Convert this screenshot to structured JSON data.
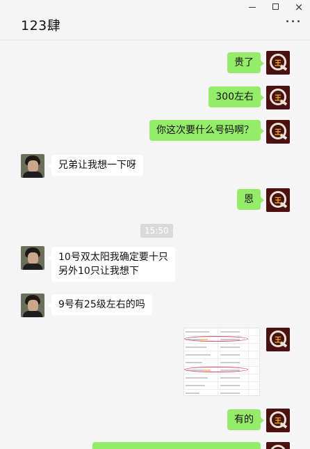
{
  "window": {
    "title": "123肆",
    "controls": {
      "minimize": "minimize",
      "maximize": "maximize",
      "close": "×"
    },
    "more_icon": "more-horizontal-icon"
  },
  "colors": {
    "background": "#f5f5f5",
    "my_bubble": "#95ec69",
    "other_bubble": "#ffffff",
    "my_avatar": "#4b1010"
  },
  "messages": [
    {
      "from": "me",
      "text": "贵了"
    },
    {
      "from": "me",
      "text": "300左右"
    },
    {
      "from": "me",
      "text": "你这次要什么号码啊？"
    },
    {
      "from": "other",
      "text": "兄弟让我想一下呀"
    },
    {
      "from": "me",
      "text": "恩"
    },
    {
      "from": "time",
      "text": "15:50"
    },
    {
      "from": "other",
      "text": "10号双太阳我确定要十只\n另外10只让我想下"
    },
    {
      "from": "other",
      "text": "9号有25级左右的吗"
    },
    {
      "from": "me",
      "type": "image",
      "image_desc": "table-screenshot"
    },
    {
      "from": "me",
      "text": "有的"
    }
  ],
  "my_avatar_glyph": "王"
}
